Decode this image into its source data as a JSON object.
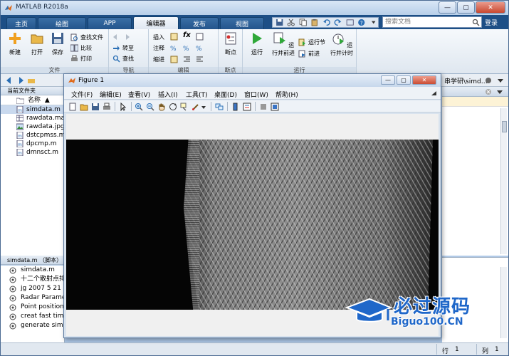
{
  "window": {
    "title": "MATLAB R2018a",
    "min": "—",
    "max": "▢",
    "close": "✕"
  },
  "tabs": [
    {
      "label": "主页",
      "active": false
    },
    {
      "label": "绘图",
      "active": false
    },
    {
      "label": "APP",
      "active": false
    },
    {
      "label": "编辑器",
      "active": true
    },
    {
      "label": "发布",
      "active": false
    },
    {
      "label": "视图",
      "active": false
    }
  ],
  "search": {
    "placeholder": "搜索文档"
  },
  "login_label": "登录",
  "ribbon": {
    "file": {
      "group_label": "文件",
      "new": "新建",
      "open": "打开",
      "save": "保存",
      "find_files": "查找文件",
      "compare": "比较",
      "print": "打印"
    },
    "navigate": {
      "group_label": "导航",
      "goto": "转至",
      "find": "查找"
    },
    "edit": {
      "group_label": "编辑",
      "insert": "插入",
      "comment": "注释",
      "indent": "缩进"
    },
    "breakpoints": {
      "group_label": "断点",
      "breakpoint": "断点"
    },
    "run": {
      "group_label": "运行",
      "run": "运行",
      "run_advance": "运行并前进",
      "run_section": "运行节",
      "advance": "前进",
      "run_time": "运行并计时"
    }
  },
  "address": {
    "path_tail": "串学研\\simd…"
  },
  "current_folder": {
    "header": "当前文件夹",
    "col_name": "名称",
    "files": [
      {
        "name": "simdata.m",
        "type": "m",
        "selected": true
      },
      {
        "name": "rawdata.mat",
        "type": "mat",
        "selected": false
      },
      {
        "name": "rawdata.jpg",
        "type": "jpg",
        "selected": false
      },
      {
        "name": "dstcpmss.m",
        "type": "m",
        "selected": false
      },
      {
        "name": "dpcmp.m",
        "type": "m",
        "selected": false
      },
      {
        "name": "dmnsct.m",
        "type": "m",
        "selected": false
      }
    ]
  },
  "details": {
    "header": "simdata.m （脚本）",
    "items": [
      "simdata.m",
      "十二个散射点排",
      "jg 2007 5 21",
      "Radar Parame",
      "Point position",
      "creat fast time",
      "generate simu"
    ]
  },
  "figure": {
    "title": "Figure 1",
    "min": "—",
    "max": "▢",
    "close": "✕",
    "menus": [
      "文件(F)",
      "编辑(E)",
      "查看(V)",
      "插入(I)",
      "工具(T)",
      "桌面(D)",
      "窗口(W)",
      "帮助(H)"
    ]
  },
  "status": {
    "row_label": "行",
    "row_value": "1",
    "col_label": "列",
    "col_value": "1"
  },
  "watermark": {
    "big": "必过源码",
    "small": "Biguo100.CN"
  },
  "colors": {
    "tabbar": "#1d4f86",
    "accent": "#1f67c9",
    "selection": "#c9d9ee"
  }
}
